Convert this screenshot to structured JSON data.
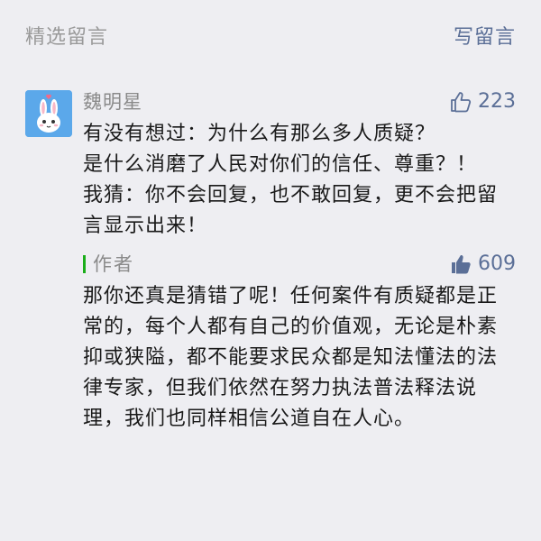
{
  "header": {
    "title": "精选留言",
    "write_label": "写留言"
  },
  "colors": {
    "accent": "#5b6f97",
    "author_bar": "#1aad19",
    "background": "#eeeef2"
  },
  "comment": {
    "avatar_icon": "bunny-avatar-icon",
    "nickname": "魏明星",
    "like_icon": "thumbs-up-outline-icon",
    "likes": "223",
    "text": "有没有想过：为什么有那么多人质疑？\n是什么消磨了人民对你们的信任、尊重？！\n我猜：你不会回复，也不敢回复，更不会把留言显示出来！"
  },
  "reply": {
    "author_label": "作者",
    "like_icon": "thumbs-up-filled-icon",
    "likes": "609",
    "text": "那你还真是猜错了呢！任何案件有质疑都是正常的，每个人都有自己的价值观，无论是朴素抑或狭隘，都不能要求民众都是知法懂法的法律专家，但我们依然在努力执法普法释法说理，我们也同样相信公道自在人心。"
  }
}
